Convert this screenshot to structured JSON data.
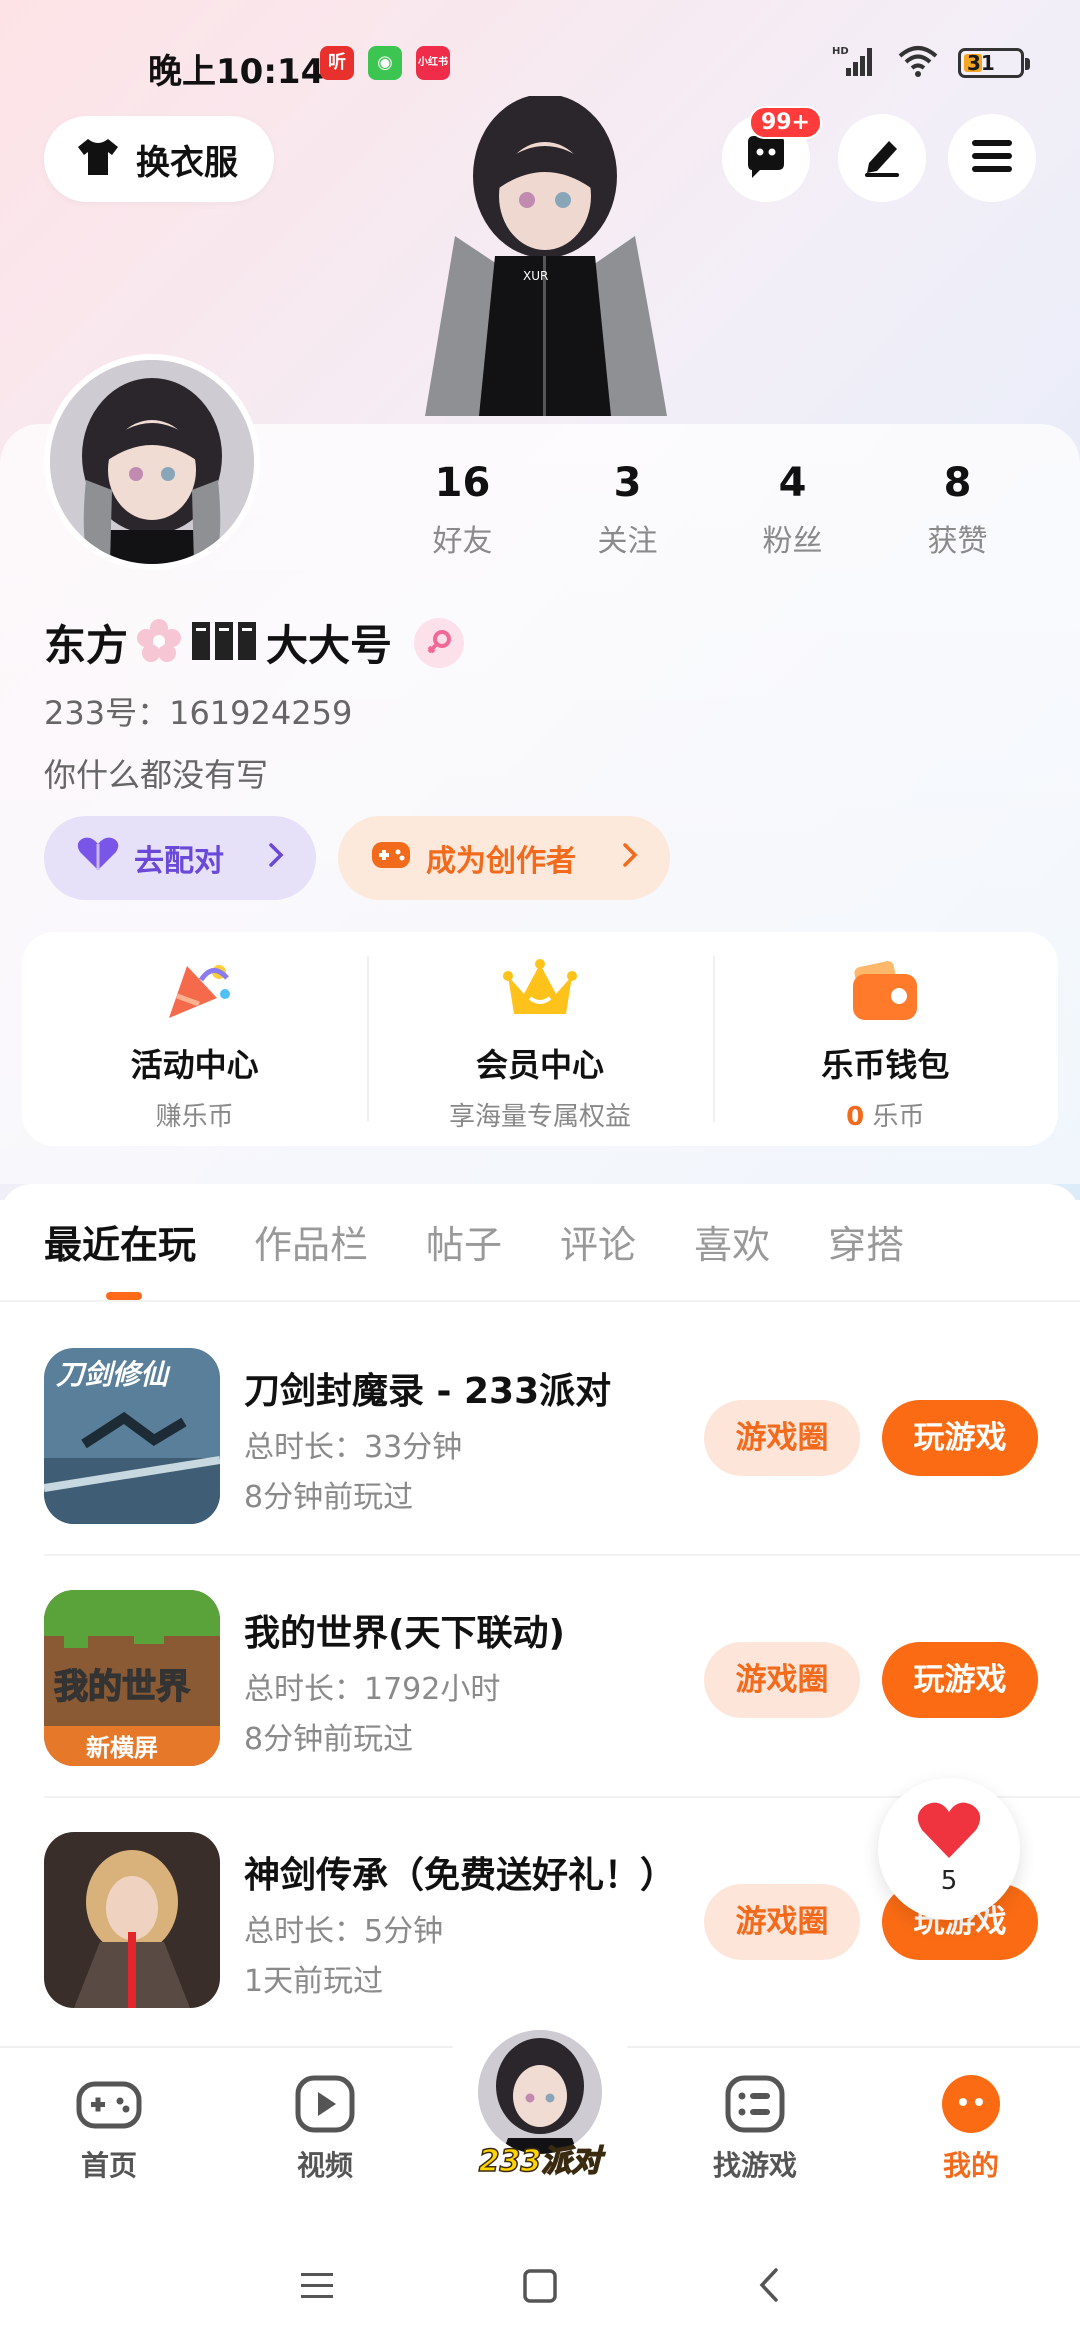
{
  "status_bar": {
    "time": "晚上10:14",
    "battery": "31",
    "network": "HD"
  },
  "header": {
    "outfit_button": "换衣服",
    "message_badge": "99+"
  },
  "profile": {
    "stats": [
      {
        "value": "16",
        "label": "好友"
      },
      {
        "value": "3",
        "label": "关注"
      },
      {
        "value": "4",
        "label": "粉丝"
      },
      {
        "value": "8",
        "label": "获赞"
      }
    ],
    "name_prefix": "东方",
    "name_suffix": "大大号",
    "id_text": "233号：161924259",
    "bio": "你什么都没有写",
    "match_chip": "去配对",
    "creator_chip": "成为创作者"
  },
  "services": [
    {
      "title": "活动中心",
      "subtitle": "赚乐币"
    },
    {
      "title": "会员中心",
      "subtitle": "享海量专属权益"
    },
    {
      "title": "乐币钱包",
      "subtitle_value": "0",
      "subtitle": "乐币"
    }
  ],
  "tabs": [
    "最近在玩",
    "作品栏",
    "帖子",
    "评论",
    "喜欢",
    "穿搭"
  ],
  "games": [
    {
      "title": "刀剑封魔录 - 233派对",
      "duration": "总时长：33分钟",
      "last_played": "8分钟前玩过",
      "icon_text": "刀剑修仙"
    },
    {
      "title": "我的世界(天下联动)",
      "duration": "总时长：1792小时",
      "last_played": "8分钟前玩过",
      "icon_text": "我的世界",
      "icon_subtext": "新横屏"
    },
    {
      "title": "神剑传承（免费送好礼！）",
      "duration": "总时长：5分钟",
      "last_played": "1天前玩过"
    }
  ],
  "game_buttons": {
    "circle": "游戏圈",
    "play": "玩游戏"
  },
  "float_like_count": "5",
  "bottom_nav": [
    {
      "label": "首页"
    },
    {
      "label": "视频"
    },
    {
      "label": "233派对"
    },
    {
      "label": "找游戏"
    },
    {
      "label": "我的"
    }
  ],
  "colors": {
    "accent": "#fa6b14",
    "purple": "#6a48d8",
    "badge": "#ff3b3b"
  }
}
